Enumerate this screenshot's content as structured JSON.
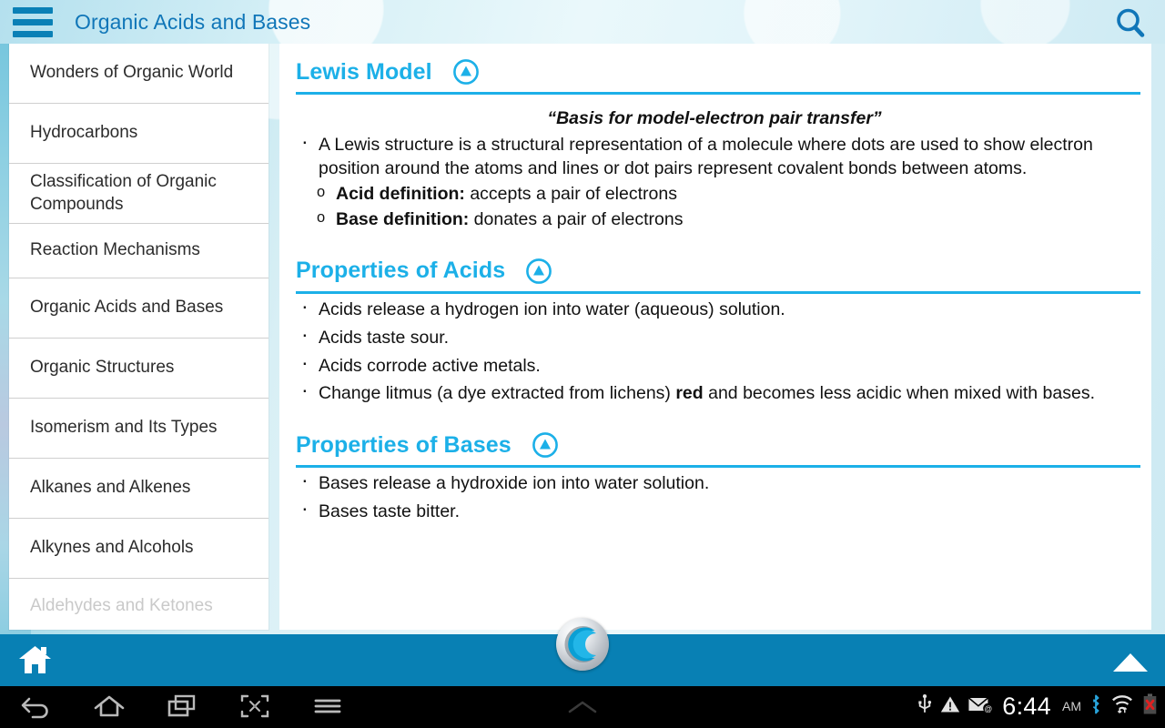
{
  "header": {
    "title": "Organic Acids and Bases",
    "menu_icon": "hamburger-icon",
    "search_icon": "search-icon"
  },
  "sidebar": {
    "items": [
      {
        "label": "Wonders of Organic World",
        "faded": false
      },
      {
        "label": "Hydrocarbons",
        "faded": false
      },
      {
        "label": "Classification of Organic Compounds",
        "faded": false
      },
      {
        "label": "Reaction Mechanisms",
        "faded": false
      },
      {
        "label": "Organic Acids and Bases",
        "faded": false
      },
      {
        "label": "Organic Structures",
        "faded": false
      },
      {
        "label": "Isomerism and Its Types",
        "faded": false
      },
      {
        "label": "Alkanes and Alkenes",
        "faded": false
      },
      {
        "label": "Alkynes and Alcohols",
        "faded": false
      },
      {
        "label": "Aldehydes and Ketones",
        "faded": true
      }
    ]
  },
  "content": {
    "sections": [
      {
        "title": "Lewis Model",
        "collapse_icon": "circle-up-arrow-icon",
        "quote": "“Basis for model-electron pair transfer”",
        "bullets": [
          "A Lewis structure is a structural representation of a molecule where dots are used to show electron position around the atoms and lines or dot pairs represent covalent bonds between atoms."
        ],
        "sub_bullets": [
          {
            "bold": "Acid definition:",
            "rest": " accepts a pair of electrons"
          },
          {
            "bold": "Base definition:",
            "rest": " donates a pair of electrons"
          }
        ]
      },
      {
        "title": "Properties of Acids",
        "collapse_icon": "circle-up-arrow-icon",
        "bullets": [
          "Acids release a hydrogen ion into water (aqueous) solution.",
          "Acids taste sour.",
          "Acids corrode active metals."
        ],
        "last_bullet": {
          "pre": "Change litmus (a dye extracted from lichens) ",
          "bold": "red",
          "post": " and becomes less acidic when mixed with bases."
        }
      },
      {
        "title": "Properties of Bases",
        "collapse_icon": "circle-up-arrow-icon",
        "bullets": [
          "Bases release a hydroxide ion into water solution.",
          "Bases taste bitter."
        ]
      }
    ]
  },
  "bottom_bar": {
    "home_icon": "home-icon",
    "up_icon": "triangle-up-icon",
    "logo_icon": "app-logo-icon"
  },
  "android_nav": {
    "buttons": [
      {
        "icon": "back-icon"
      },
      {
        "icon": "home-icon"
      },
      {
        "icon": "recent-apps-icon"
      },
      {
        "icon": "screenshot-icon"
      },
      {
        "icon": "menu-icon"
      }
    ],
    "chevron_icon": "chevron-up-icon"
  },
  "status_bar": {
    "icons": [
      "usb-icon",
      "warning-icon",
      "email-icon",
      "bluetooth-icon",
      "wifi-icon",
      "battery-error-icon"
    ],
    "time": "6:44",
    "meridiem": "AM"
  },
  "colors": {
    "accent": "#1cb0e8",
    "bar_blue": "#0880b4",
    "title_blue": "#1076b8",
    "menu_blue": "#0a80b6"
  }
}
